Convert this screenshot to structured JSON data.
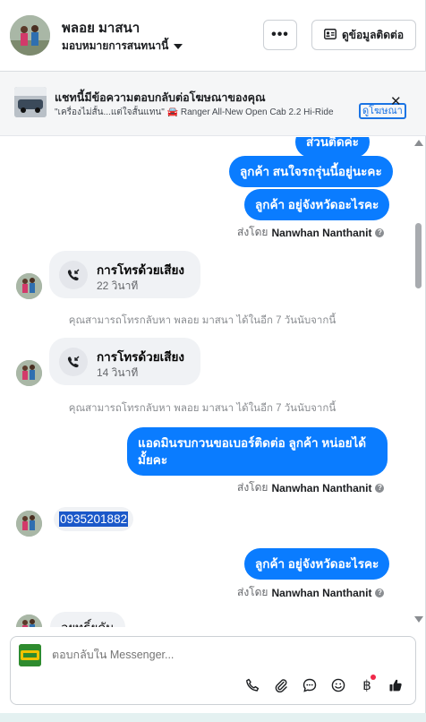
{
  "header": {
    "contact_name": "พลอย มาสนา",
    "assign_label": "มอบหมายการสนทนานี้",
    "more_label": "•••",
    "contact_info_label": "ดูข้อมูลติดต่อ"
  },
  "ad_banner": {
    "title": "แชทนี้มีข้อความตอบกลับต่อโฆษณาของคุณ",
    "subtitle": "\"เครื่องไม่สั้น...แต่ใจสั้นแทน\" 🚘 Ranger All-New Open Cab 2.2 Hi-Ride",
    "view_ad_label": "ดูโฆษณา",
    "close_label": "✕"
  },
  "messages": {
    "out_partial": "ส่วนติดค่ะ",
    "out1": "ลูกค้า สนใจรถรุ่นนี้อยู่นะคะ",
    "out2": "ลูกค้า อยู่จังหวัดอะไรคะ",
    "sent_by_prefix": "ส่งโดย",
    "sent_by_name": "Nanwhan Nanthanit",
    "info_glyph": "?",
    "call_title": "การโทรด้วยเสียง",
    "call1_duration": "22 วินาที",
    "call_back_note": "คุณสามารถโทรกลับหา พลอย มาสนา ได้ในอีก 7 วันนับจากนี้",
    "call2_duration": "14 วินาที",
    "out3": "แอดมินรบกวนขอเบอร์ติดต่อ ลูกค้า หน่อยได้มั้ยคะ",
    "in_phone": "0935201882",
    "out4": "ลูกค้า อยู่จังหวัดอะไรคะ",
    "in_partial": "ลยุทธิ์ยคัน"
  },
  "composer": {
    "placeholder": "ตอบกลับใน Messenger...",
    "baht_symbol": "฿"
  },
  "colors": {
    "outgoing_bubble": "#0a7cff",
    "incoming_bubble": "#f0f2f5",
    "selection": "#1b58c9",
    "notification_dot": "#f02849"
  }
}
